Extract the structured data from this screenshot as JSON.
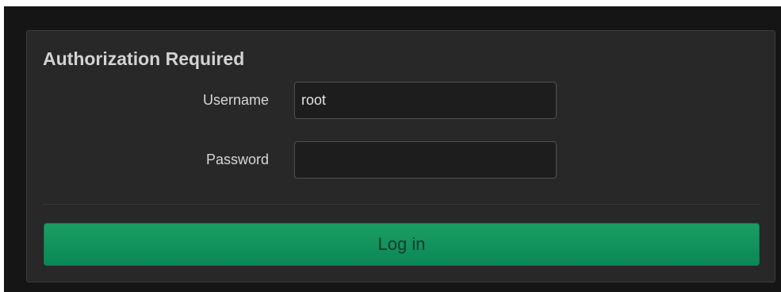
{
  "panel": {
    "title": "Authorization Required"
  },
  "form": {
    "username_label": "Username",
    "username_value": "root",
    "password_label": "Password",
    "password_value": ""
  },
  "actions": {
    "login_label": "Log in"
  },
  "colors": {
    "background": "#151515",
    "panel": "#282828",
    "accent": "#0a8756"
  }
}
